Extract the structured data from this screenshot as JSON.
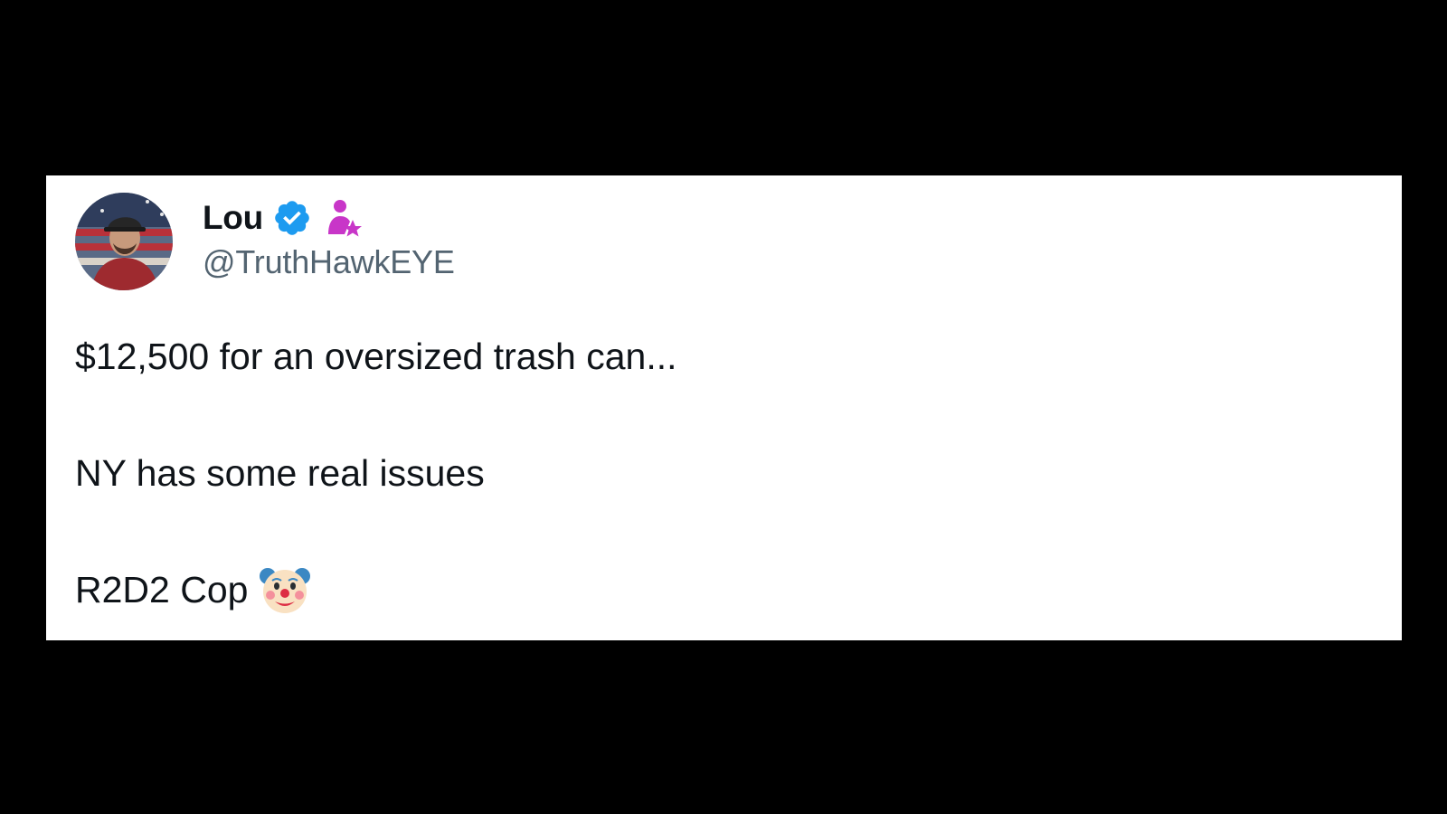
{
  "post": {
    "author": {
      "display_name": "Lou",
      "handle": "@TruthHawkEYE",
      "verified_icon": "verified-badge-icon",
      "affiliation_icon": "affiliate-person-star-icon"
    },
    "lines": [
      "$12,500 for an oversized trash can...",
      "NY has some real issues",
      "R2D2 Cop"
    ],
    "trailing_emoji": "clown-face-icon"
  },
  "colors": {
    "background": "#000000",
    "card": "#ffffff",
    "text": "#0f1419",
    "handle": "#536471",
    "verified": "#1d9bf0",
    "affiliate": "#c836c8"
  }
}
